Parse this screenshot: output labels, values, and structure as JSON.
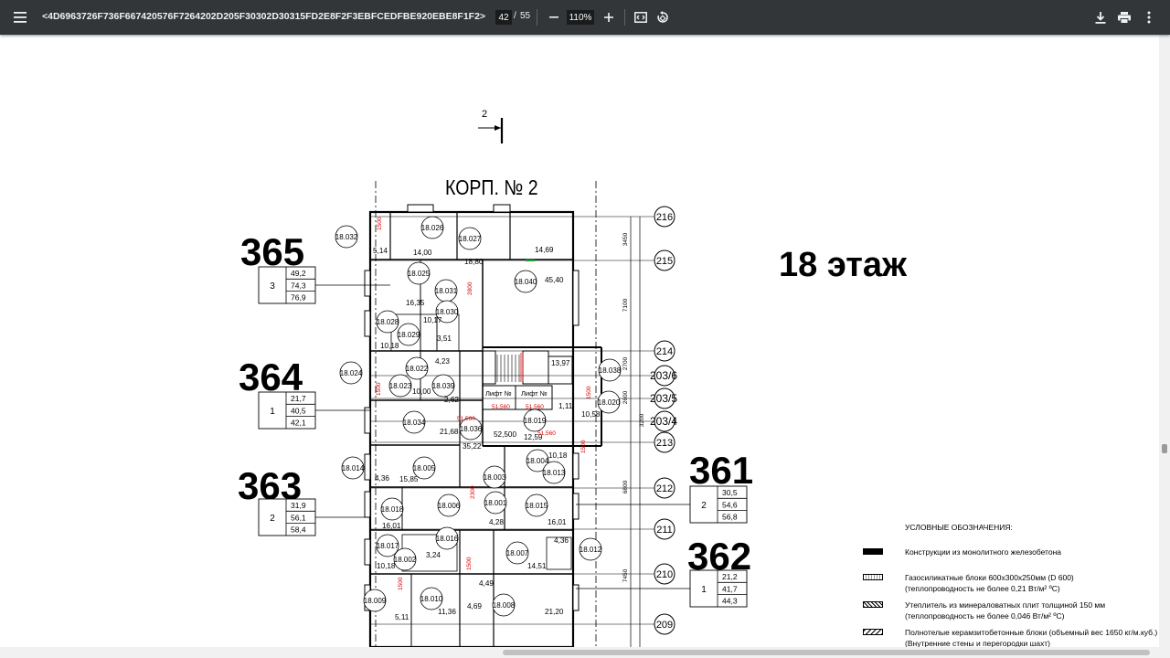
{
  "toolbar": {
    "title": "<4D6963726F736F667420576F7264202D205F30302D30315FD2E8F2F3EBFCEDFBE920EBE8F1F2>",
    "page_current": "42",
    "page_sep": "/",
    "page_total": "55",
    "zoom": "110%",
    "icons": [
      "menu-icon",
      "zoom-out-icon",
      "zoom-in-icon",
      "fit-page-icon",
      "rotate-icon",
      "download-icon",
      "print-icon",
      "more-vert-icon"
    ]
  },
  "drawing": {
    "building_title": "КОРП. № 2",
    "section_mark": "2",
    "floor_label": "18 этаж",
    "apartments": [
      {
        "number": "365",
        "rooms": "3",
        "areas": [
          "49,2",
          "74,3",
          "76,9"
        ]
      },
      {
        "number": "364",
        "rooms": "1",
        "areas": [
          "21,7",
          "40,5",
          "42,1"
        ]
      },
      {
        "number": "363",
        "rooms": "2",
        "areas": [
          "31,9",
          "56,1",
          "58,4"
        ]
      },
      {
        "number": "361",
        "rooms": "2",
        "areas": [
          "30,5",
          "54,6",
          "56,8"
        ]
      },
      {
        "number": "362",
        "rooms": "1",
        "areas": [
          "21,2",
          "41,7",
          "44,3"
        ]
      }
    ],
    "axes": [
      "216",
      "215",
      "214",
      "203/6",
      "203/5",
      "203/4",
      "213",
      "212",
      "211",
      "210",
      "209"
    ],
    "dims": [
      "3450",
      "7100",
      "2700",
      "2600",
      "3200",
      "6800",
      "7450"
    ],
    "rooms": [
      {
        "id": "18.032"
      },
      {
        "id": "18.026"
      },
      {
        "id": "18.027"
      },
      {
        "id": "18.025"
      },
      {
        "id": "18.031"
      },
      {
        "id": "18.040"
      },
      {
        "id": "18.030"
      },
      {
        "id": "18.028"
      },
      {
        "id": "18.029"
      },
      {
        "id": "18.024"
      },
      {
        "id": "18.022"
      },
      {
        "id": "18.023"
      },
      {
        "id": "18.039"
      },
      {
        "id": "18.038"
      },
      {
        "id": "18.036"
      },
      {
        "id": "18.020"
      },
      {
        "id": "18.034"
      },
      {
        "id": "18.019"
      },
      {
        "id": "18.014"
      },
      {
        "id": "18.005"
      },
      {
        "id": "18.003"
      },
      {
        "id": "18.004"
      },
      {
        "id": "18.013"
      },
      {
        "id": "18.018"
      },
      {
        "id": "18.006"
      },
      {
        "id": "18.001"
      },
      {
        "id": "18.015"
      },
      {
        "id": "18.017"
      },
      {
        "id": "18.016"
      },
      {
        "id": "18.002"
      },
      {
        "id": "18.007"
      },
      {
        "id": "18.012"
      },
      {
        "id": "18.009"
      },
      {
        "id": "18.010"
      },
      {
        "id": "18.008"
      }
    ],
    "room_areas": [
      "5,14",
      "14,00",
      "18,80",
      "14,69",
      "45,40",
      "16,35",
      "10,17",
      "10,18",
      "3,51",
      "4,23",
      "10,00",
      "2,62",
      "13,97",
      "10,58",
      "21,68",
      "52,500",
      "12,59",
      "35,22",
      "4,36",
      "15,85",
      "10,18",
      "16,01",
      "4,28",
      "16,01",
      "4,36",
      "10,18",
      "14,51",
      "4,49",
      "5,11",
      "11,36",
      "4,69",
      "21,20",
      "3,24",
      "1,11"
    ],
    "lift_labels": [
      "Лифт №",
      "Лифт №"
    ],
    "elevations": [
      "51,560",
      "51,560",
      "51,560",
      "51,560",
      "1500",
      "1500",
      "1500",
      "1500",
      "2800",
      "2300",
      "1500",
      "1500"
    ],
    "area_tags": [
      "2,62"
    ]
  },
  "legend": {
    "title": "УСЛОВНЫЕ ОБОЗНАЧЕНИЯ:",
    "items": [
      {
        "lines": [
          "Конструкции из монолитного железобетона"
        ]
      },
      {
        "lines": [
          "Газосиликатные блоки 600х300х250мм (D 600)",
          "(теплопроводность не более 0,21 Вт/м² ºС)"
        ]
      },
      {
        "lines": [
          "Утеплитель из минераловатных плит толщиной 150 мм",
          "(теплопроводность не более 0,046 Вт/м² ºС)"
        ]
      },
      {
        "lines": [
          "Полнотелые керамзитобетонные блоки (объемный вес 1650 кг/м.куб.)",
          "(Внутренние стены и перегородки шахт)"
        ]
      }
    ]
  }
}
